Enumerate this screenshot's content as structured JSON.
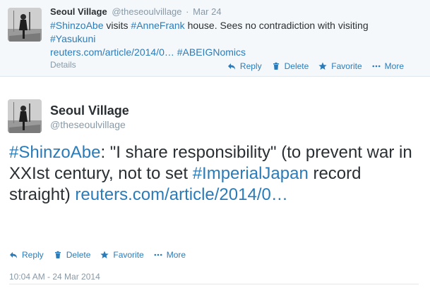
{
  "small_tweet": {
    "name": "Seoul Village",
    "handle": "@theseoulvillage",
    "separator": "·",
    "time": "Mar 24",
    "text": {
      "tag1": "#ShinzoAbe",
      "part1": " visits ",
      "tag2": "#AnneFrank",
      "part2": " house. Sees no contradiction with visiting ",
      "tag3": "#Yasukuni",
      "link": "reuters.com/article/2014/0…",
      "tag4": "#ABEIGNomics"
    },
    "details_label": "Details",
    "actions": {
      "reply": "Reply",
      "delete": "Delete",
      "favorite": "Favorite",
      "more": "More"
    }
  },
  "main_tweet": {
    "name": "Seoul Village",
    "handle": "@theseoulvillage",
    "text": {
      "tag1": "#ShinzoAbe",
      "part1": ": \"I share responsibility\" (to prevent war in XXIst century, not to set ",
      "tag2": "#ImperialJapan",
      "part2": " record straight) ",
      "link": "reuters.com/article/2014/0…"
    },
    "actions": {
      "reply": "Reply",
      "delete": "Delete",
      "favorite": "Favorite",
      "more": "More"
    },
    "timestamp": "10:04 AM - 24 Mar 2014"
  },
  "colors": {
    "link": "#2b7bb9",
    "muted": "#8899a6",
    "text": "#292f33",
    "highlight_bg": "#f5f8fa"
  },
  "icons": [
    "reply-icon",
    "trash-icon",
    "star-icon",
    "ellipsis-icon"
  ]
}
